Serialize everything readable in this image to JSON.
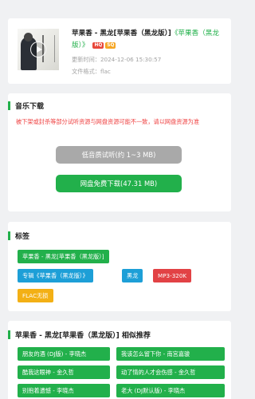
{
  "song": {
    "title_main": "苹果香 - 黑龙[苹果香（黑龙版）]",
    "album": "《苹果香（黑龙版）》",
    "badges": [
      "HQ",
      "SQ"
    ],
    "updated": "更新时间：2024-12-06 15:30:57",
    "format": "文件格式：flac"
  },
  "download": {
    "title": "音乐下载",
    "notice": "被下架或封杀等部分试听资源与网盘资源可能不一致，请以网盘资源为准",
    "low_quality_label": "低音质试听(约 1~3 MB)",
    "netdisk_label": "网盘免费下载(47.31 MB)"
  },
  "tags": {
    "title": "标签",
    "items": [
      {
        "label": "苹果香 - 黑龙[苹果香（黑龙版）]",
        "color": "#22b04b"
      },
      {
        "label": "专辑《苹果香（黑龙版）》",
        "color": "#1d9fd7"
      },
      {
        "label": "黑龙",
        "color": "#1d9fd7"
      },
      {
        "label": "MP3-320K",
        "color": "#e24245"
      },
      {
        "label": "FLAC无损",
        "color": "#f3b015"
      }
    ]
  },
  "recommend": {
    "title": "苹果香 - 黑龙[苹果香（黑龙版）] 相似推荐",
    "items": [
      "朋友的酒 (DJ版) - 李晓杰",
      "我该怎么留下你 - 南宫嘉骏",
      "酷我这眼神 - 金久哲",
      "动了情的人才会伤感 - 金久哲",
      "别抱着遗憾 - 李晓杰",
      "老大 (DJ默认版) - 李晓杰"
    ]
  },
  "colors": {
    "accent": "#22b04b",
    "warning": "#ef4040",
    "background": "#f0f1f3"
  }
}
